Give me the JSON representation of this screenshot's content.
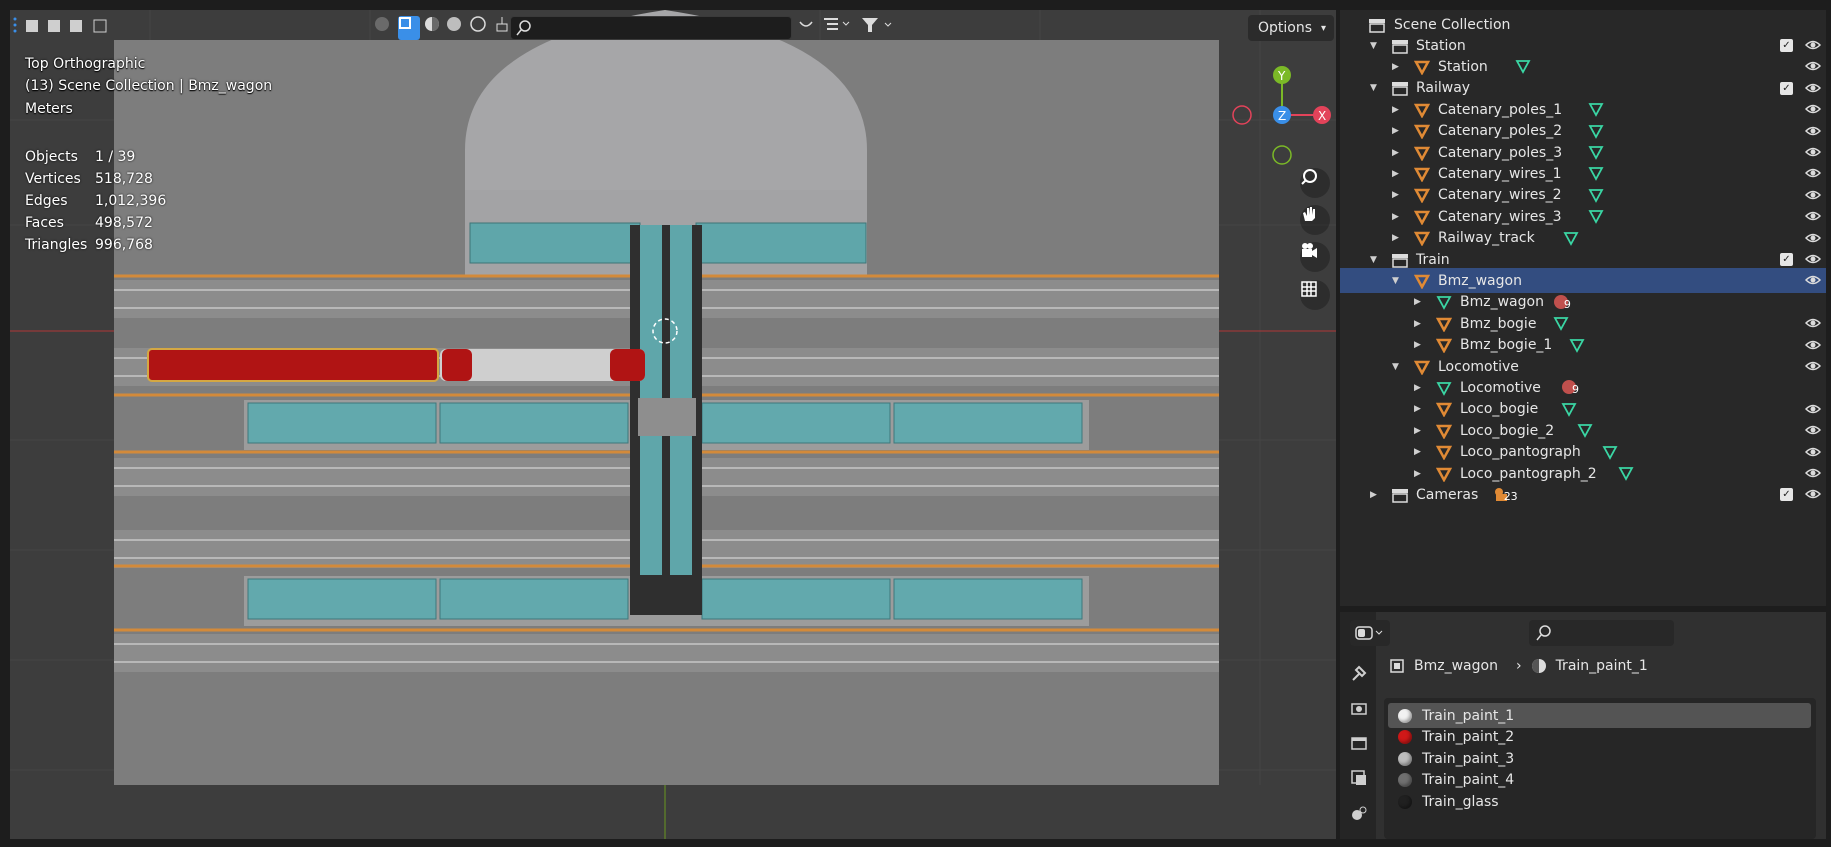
{
  "viewport": {
    "view_name": "Top Orthographic",
    "context": "(13) Scene Collection | Bmz_wagon",
    "units": "Meters",
    "stats": [
      {
        "label": "Objects",
        "value": "1 / 39"
      },
      {
        "label": "Vertices",
        "value": "518,728"
      },
      {
        "label": "Edges",
        "value": "1,012,396"
      },
      {
        "label": "Faces",
        "value": "498,572"
      },
      {
        "label": "Triangles",
        "value": "996,768"
      }
    ],
    "options_label": "Options",
    "search_placeholder": "",
    "gizmo": {
      "y": "Y",
      "z": "Z",
      "x": "X"
    }
  },
  "outliner": {
    "root": "Scene Collection",
    "rows": [
      {
        "label": "Station"
      },
      {
        "label": "Station"
      },
      {
        "label": "Railway"
      },
      {
        "label": "Catenary_poles_1"
      },
      {
        "label": "Catenary_poles_2"
      },
      {
        "label": "Catenary_poles_3"
      },
      {
        "label": "Catenary_wires_1"
      },
      {
        "label": "Catenary_wires_2"
      },
      {
        "label": "Catenary_wires_3"
      },
      {
        "label": "Railway_track"
      },
      {
        "label": "Train"
      },
      {
        "label": "Bmz_wagon"
      },
      {
        "label": "Bmz_wagon",
        "badge": "9"
      },
      {
        "label": "Bmz_bogie"
      },
      {
        "label": "Bmz_bogie_1"
      },
      {
        "label": "Locomotive"
      },
      {
        "label": "Locomotive",
        "badge": "9"
      },
      {
        "label": "Loco_bogie"
      },
      {
        "label": "Loco_bogie_2"
      },
      {
        "label": "Loco_pantograph"
      },
      {
        "label": "Loco_pantograph_2"
      },
      {
        "label": "Cameras",
        "badge": "23"
      }
    ]
  },
  "properties": {
    "breadcrumb_object": "Bmz_wagon",
    "breadcrumb_material": "Train_paint_1",
    "materials": [
      {
        "label": "Train_paint_1",
        "color": "#f2f2f2"
      },
      {
        "label": "Train_paint_2",
        "color": "#d01818"
      },
      {
        "label": "Train_paint_3",
        "color": "#bdbdbd"
      },
      {
        "label": "Train_paint_4",
        "color": "#707070"
      },
      {
        "label": "Train_glass",
        "color": "#202020"
      }
    ]
  },
  "colors": {
    "accent": "#334d80",
    "object_icon": "#e08a35",
    "mesh_icon": "#3ad6a4",
    "axis_x": "#e3435a",
    "axis_y": "#7bb927",
    "axis_z": "#3a8fe8"
  }
}
